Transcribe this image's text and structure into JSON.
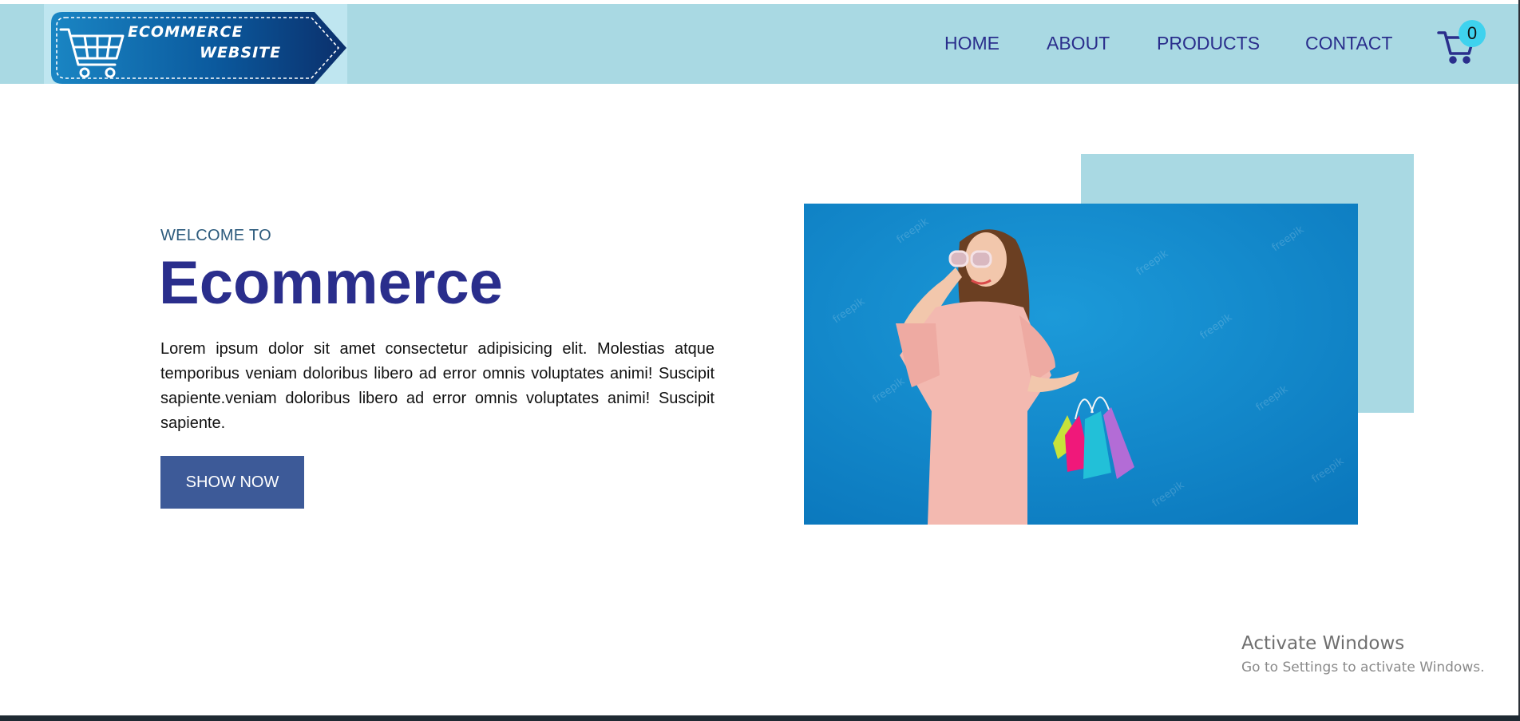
{
  "brand": {
    "line1": "ECOMMERCE",
    "line2": "WEBSITE",
    "color": "#0d4a8c"
  },
  "nav": {
    "items": [
      {
        "label": "HOME"
      },
      {
        "label": "ABOUT"
      },
      {
        "label": "PRODUCTS"
      },
      {
        "label": "CONTACT"
      }
    ],
    "cart_count": "0"
  },
  "hero": {
    "eyebrow": "WELCOME TO",
    "title": "Ecommerce",
    "description": "Lorem ipsum dolor sit amet consectetur adipisicing elit. Molestias atque temporibus veniam doloribus libero ad error omnis voluptates animi! Suscipit sapiente.veniam doloribus libero ad error omnis voluptates animi! Suscipit sapiente.",
    "button_label": "SHOW NOW"
  },
  "windows_watermark": {
    "title": "Activate Windows",
    "subtitle": "Go to Settings to activate Windows."
  },
  "colors": {
    "navbar_bg": "#a9d9e3",
    "accent": "#2a2e8c",
    "button_bg": "#3d5a98",
    "badge": "#3fd2ee"
  }
}
